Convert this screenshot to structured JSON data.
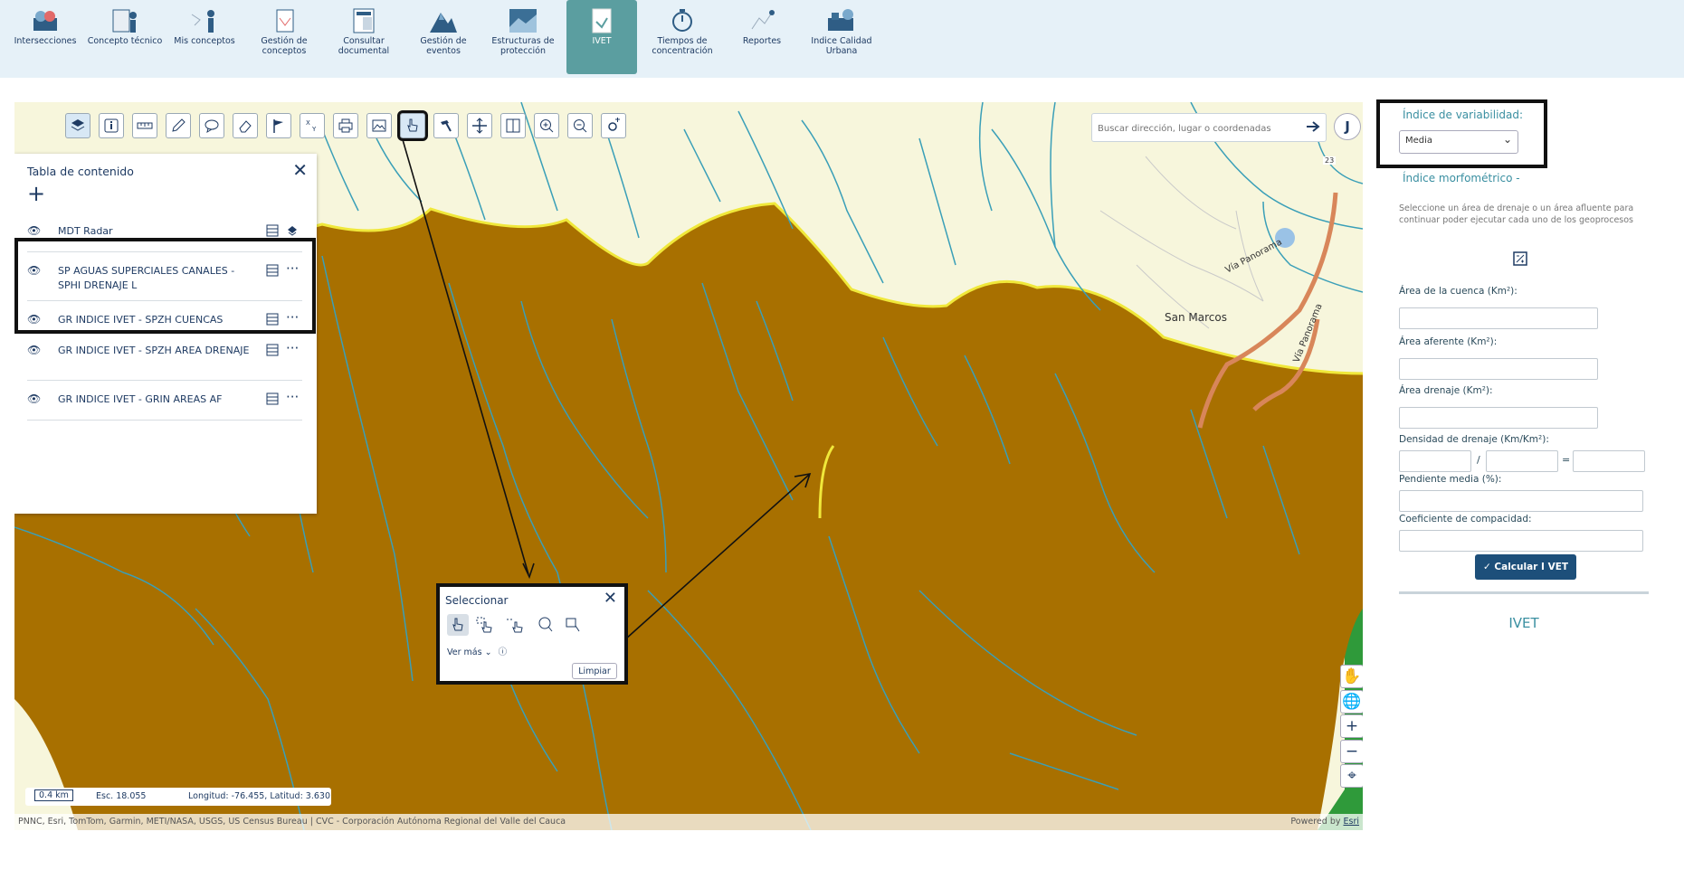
{
  "nav": {
    "items": [
      {
        "label": "Intersecciones"
      },
      {
        "label": "Concepto técnico"
      },
      {
        "label": "Mis conceptos"
      },
      {
        "label": "Gestión de conceptos"
      },
      {
        "label": "Consultar documental"
      },
      {
        "label": "Gestión de eventos"
      },
      {
        "label": "Estructuras de protección"
      },
      {
        "label": "IVET"
      },
      {
        "label": "Tiempos de concentración"
      },
      {
        "label": "Reportes"
      },
      {
        "label": "Indice Calidad Urbana"
      }
    ],
    "active_index": 7,
    "active_color": "#5b9ea0"
  },
  "map": {
    "search_placeholder": "Buscar dirección, lugar o coordenadas",
    "user_initial": "J",
    "place_label": "San Marcos",
    "road_label_1": "Vía Panorama",
    "road_label_2": "Vía Panorama",
    "road_number": "23",
    "terrain_color": "#a87000",
    "river_color": "#3a9fb8",
    "boundary_color": "#f0e83a",
    "scale": {
      "bar": "0.4 km",
      "scale_text": "Esc. 18.055",
      "coords": "Longitud: -76.455, Latitud: 3.630"
    },
    "attribution_left": "PNNC, Esri, TomTom, Garmin, METI/NASA, USGS, US Census Bureau | CVC - Corporación Autónoma Regional del Valle del Cauca",
    "attribution_powered": "Powered by",
    "attribution_esri": "Esri"
  },
  "toolbar": {
    "tools": [
      "layers-icon",
      "info-icon",
      "measure-icon",
      "draw-icon",
      "comment-icon",
      "eraser-icon",
      "flag-icon",
      "coordinate-icon",
      "print-icon",
      "image-icon",
      "select-icon",
      "hammer-icon",
      "move-icon",
      "split-icon",
      "zoom-in-icon",
      "zoom-out-icon",
      "settings-icon"
    ]
  },
  "toc": {
    "title": "Tabla de contenido",
    "layers": [
      {
        "name": "MDT Radar"
      },
      {
        "name": "SP AGUAS SUPERCIALES CANALES - SPHI DRENAJE L"
      },
      {
        "name": "GR INDICE IVET - SPZH CUENCAS"
      },
      {
        "name": "GR INDICE IVET - SPZH AREA DRENAJE"
      },
      {
        "name": "GR INDICE IVET - GRIN AREAS AF"
      }
    ]
  },
  "select_panel": {
    "title": "Seleccionar",
    "more": "Ver más",
    "clear": "Limpiar"
  },
  "side": {
    "variability_label": "Índice de variabilidad:",
    "variability_value": "Media",
    "morpho_label": "Índice morfométrico -",
    "description": "Seleccione un área de drenaje o un área afluente para continuar poder ejecutar cada uno de los geoprocesos",
    "fields": [
      {
        "label": "Área de la cuenca (Km²):"
      },
      {
        "label": "Área aferente (Km²):"
      },
      {
        "label": "Área drenaje (Km²):"
      },
      {
        "label": "Densidad de drenaje (Km/Km²):"
      },
      {
        "label": "Pendiente media (%):"
      },
      {
        "label": "Coeficiente de compacidad:"
      }
    ],
    "density_div": "/",
    "density_eq": "=",
    "calc_button": "✓ Calcular I VET",
    "result_title": "IVET"
  }
}
